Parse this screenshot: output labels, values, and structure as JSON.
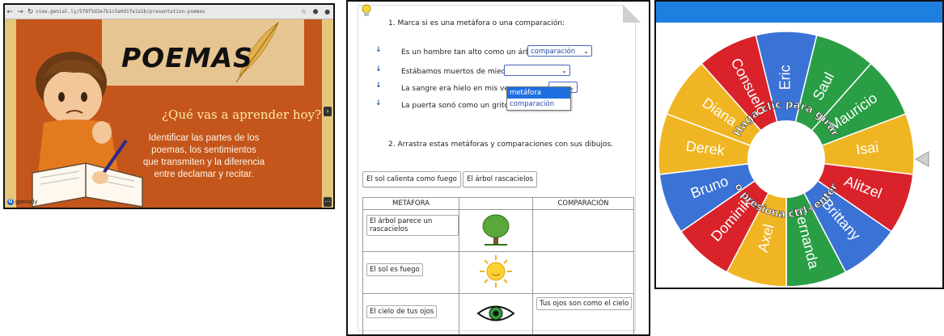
{
  "presentation": {
    "url": "view.genial.ly/5f8f5d3e7b1c5a0d1fe1a1b/presentation-poemas",
    "title": "POEMAS",
    "subtitle": "¿Qué vas a aprender hoy?",
    "body": "Identificar las partes de los poemas, los sentimientos que transmiten y la diferencia entre declamar y recitar.",
    "logo": "genially",
    "icons": [
      "back-icon",
      "forward-icon",
      "reload-icon",
      "star-icon",
      "extension-icon",
      "profile-icon",
      "next-slide-icon",
      "menu-icon"
    ]
  },
  "worksheet": {
    "q1": "1.  Marca si es una metáfora o una comparación:",
    "items": [
      {
        "text": "Es un hombre tan alto como un árbol.",
        "value": "comparación"
      },
      {
        "text": "Estábamos muertos de miedo.",
        "value": ""
      },
      {
        "text": "La sangre era hielo en mis venas",
        "value": ""
      },
      {
        "text": "La puerta sonó como un grito.",
        "value": ""
      }
    ],
    "dropdown_options": [
      "metáfora",
      "comparación"
    ],
    "q2": "2.  Arrastra estas metáforas y comparaciones con sus dibujos.",
    "chips": [
      "El sol calienta como fuego",
      "El árbol rascacielos"
    ],
    "table_headers": [
      "METÁFORA",
      "",
      "COMPARACIÓN"
    ],
    "rows": [
      {
        "metafora": "El árbol parece un rascacielos",
        "image": "tree-icon",
        "comparacion": ""
      },
      {
        "metafora": "El sol es fuego",
        "image": "sun-icon",
        "comparacion": ""
      },
      {
        "metafora": "El cielo de tus ojos",
        "image": "eye-icon",
        "comparacion": "Tus ojos son como el cielo"
      }
    ]
  },
  "wheel": {
    "names": [
      "Eric",
      "Saul",
      "Mauricio",
      "Isai",
      "Alitzel",
      "Brittany",
      "Fernanda",
      "Axel",
      "Dominik",
      "Bruno",
      "Derek",
      "Diana",
      "Consuelo"
    ],
    "colors": [
      "#3b72d6",
      "#2a9e45",
      "#2a9e45",
      "#f0b522",
      "#d9222a",
      "#3b72d6",
      "#2a9e45",
      "#f0b522",
      "#d9222a",
      "#3b72d6",
      "#f0b522",
      "#f0b522",
      "#d9222a"
    ],
    "center_text_top": "Haga clic para girar",
    "center_text_bottom": "o presiona ctrl+enter",
    "accent": "#1f7fe0"
  }
}
